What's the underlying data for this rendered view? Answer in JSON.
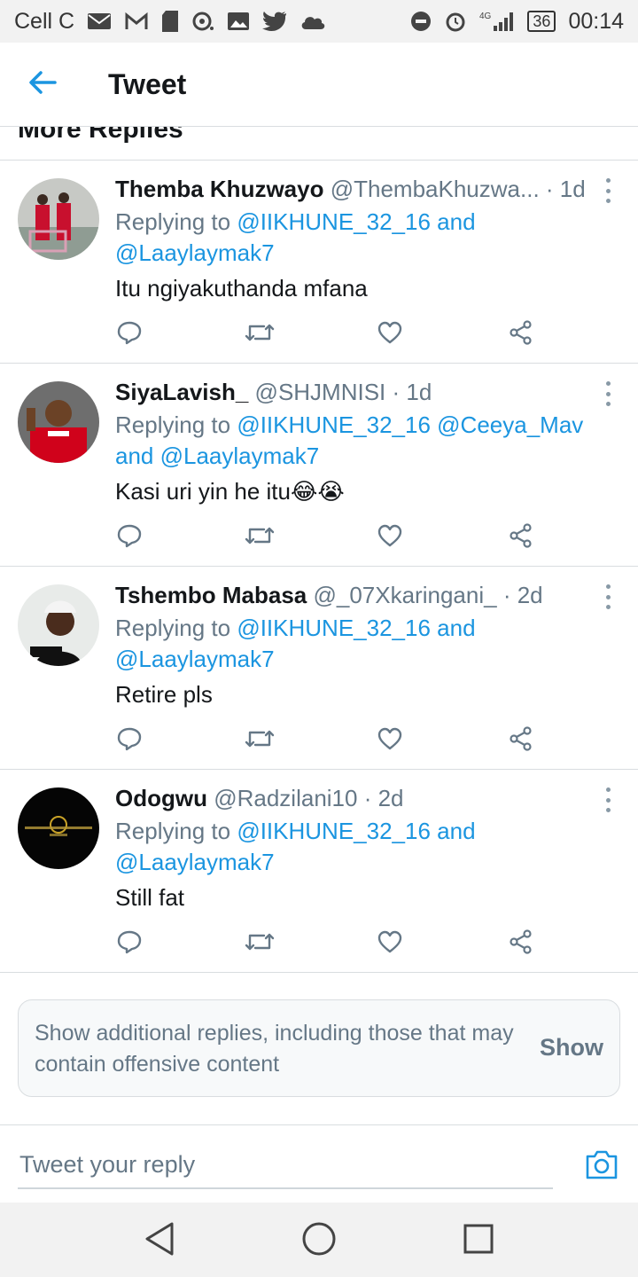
{
  "status_bar": {
    "carrier": "Cell C",
    "network": "4G",
    "battery": "36",
    "time": "00:14",
    "icons": [
      "mail-icon",
      "gmail-icon",
      "sd-card-icon",
      "camera-status-icon",
      "gallery-icon",
      "twitter-icon",
      "cloud-icon",
      "dnd-icon",
      "alarm-icon",
      "signal-icon"
    ]
  },
  "header": {
    "title": "Tweet",
    "back_icon": "arrow-left-icon"
  },
  "section_heading": "More Replies",
  "replies": [
    {
      "name": "Themba Khuzwayo",
      "handle": "@ThembaKhuzwa...",
      "time": "· 1d",
      "replying_prefix": "Replying to",
      "replying_line1": "@IIKHUNE_32_16 and",
      "replying_line2": "@Laaylaymak7",
      "text": "Itu ngiyakuthanda mfana"
    },
    {
      "name": "SiyaLavish_",
      "handle": "@SHJMNISI",
      "time": "· 1d",
      "replying_prefix": "Replying to",
      "replying_line1": "@IIKHUNE_32_16 @Ceeya_Mav",
      "replying_line2": "and @Laaylaymak7",
      "text": "Kasi uri yin he itu😂😭"
    },
    {
      "name": "Tshembo Mabasa",
      "handle": "@_07Xkaringani_",
      "time": "· 2d",
      "replying_prefix": "Replying to",
      "replying_line1": "@IIKHUNE_32_16 and",
      "replying_line2": "@Laaylaymak7",
      "text": "Retire pls"
    },
    {
      "name": "Odogwu",
      "handle": "@Radzilani10",
      "time": "· 2d",
      "replying_prefix": "Replying to",
      "replying_line1": "@IIKHUNE_32_16 and",
      "replying_line2": "@Laaylaymak7",
      "text": "Still fat"
    }
  ],
  "show_more": {
    "text": "Show additional replies, including those that may contain offensive content",
    "button": "Show"
  },
  "composer": {
    "placeholder": "Tweet your reply"
  },
  "colors": {
    "accent": "#1b95e0",
    "secondary_text": "#657786",
    "divider": "#d9dde0"
  }
}
